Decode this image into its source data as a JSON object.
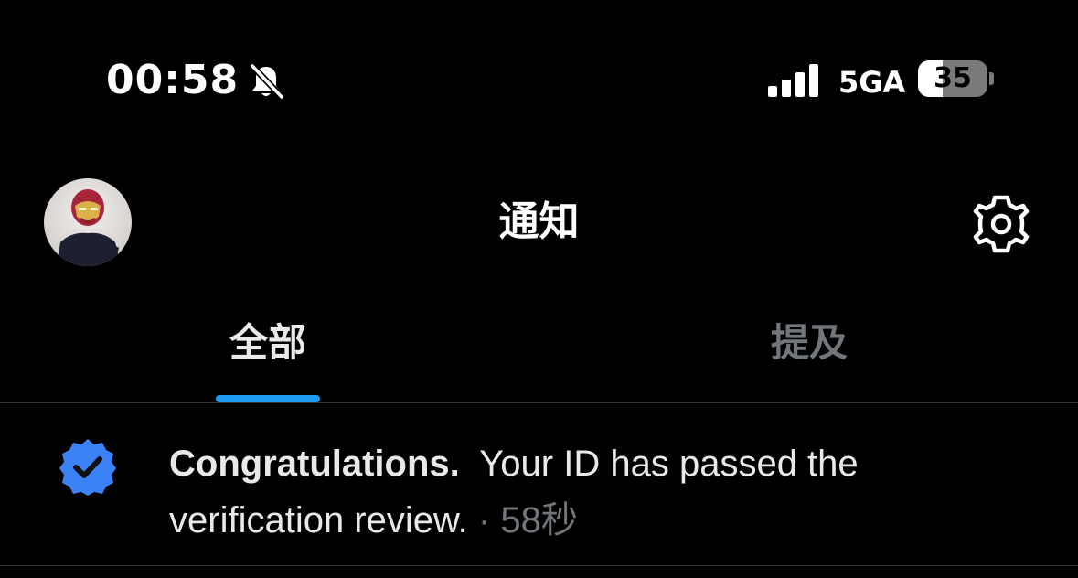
{
  "status_bar": {
    "time": "00:58",
    "network": "5GA",
    "battery_level": "35",
    "battery_fraction": 0.35,
    "icons": [
      "bell-slash-icon",
      "signal-bars-icon",
      "battery-icon"
    ]
  },
  "header": {
    "title": "通知",
    "avatar_icon": "user-avatar",
    "settings_icon": "gear-icon"
  },
  "tabs": [
    {
      "label": "全部",
      "active": true
    },
    {
      "label": "提及",
      "active": false
    }
  ],
  "notification": {
    "icon": "verified-badge-icon",
    "title": "Congratulations.",
    "message": "Your ID has passed the verification review.",
    "separator": "·",
    "time": "58秒"
  },
  "colors": {
    "background": "#000000",
    "accent": "#1d9bf0",
    "text_primary": "#e7e9ea",
    "text_muted": "#71767b",
    "divider": "#2f3336"
  }
}
